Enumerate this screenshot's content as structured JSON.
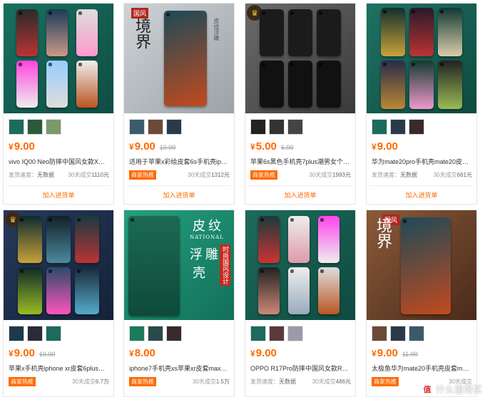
{
  "add_label": "加入进货单",
  "tag_label": "商家热推",
  "ship_label": "发货速度：",
  "ship_value": "无数据",
  "sales_prefix": "30天成交",
  "colors": {
    "accent": "#ff6a00"
  },
  "products": [
    {
      "price": "9.00",
      "original": "",
      "title": "vivo IQ00 Neo防摔中国风女款X27Pro...",
      "show_tag": false,
      "ship_value": "无数据",
      "sales": "1110元",
      "bg": "#1f6e5f",
      "image_text": ""
    },
    {
      "price": "9.00",
      "original": "10.00",
      "title": "适用于苹果x彩绘皮套6s手机壳iphone...",
      "show_tag": true,
      "sales": "1312元",
      "bg": "#274a55",
      "image_text": "境界"
    },
    {
      "price": "5.00",
      "original": "6.00",
      "title": "苹果6s黑色手机壳7plus潮男女个性六...",
      "show_tag": true,
      "sales": "1993元",
      "bg": "#555555",
      "image_text": ""
    },
    {
      "price": "9.00",
      "original": "",
      "title": "华为mate20pro手机壳mate20皮纹20x...",
      "show_tag": false,
      "ship_value": "无数据",
      "sales": "661元",
      "bg": "#1d6f60",
      "image_text": ""
    },
    {
      "price": "9.00",
      "original": "10.00",
      "title": "苹果x手机壳iphone xr皮套6plus浮雕...",
      "show_tag": true,
      "sales": "6.7万",
      "bg": "#1f2f4a",
      "image_text": ""
    },
    {
      "price": "8.00",
      "original": "",
      "title": "iphone7手机壳xs苹果xr皮套max华为...",
      "show_tag": true,
      "sales": "1.5万",
      "bg": "#1e8a6e",
      "image_text": "皮纹 NATIONAL 浮雕壳 时尚国风设计"
    },
    {
      "price": "9.00",
      "original": "",
      "title": "OPPO R17Pro防摔中国风女款R17手...",
      "show_tag": false,
      "ship_value": "无数据",
      "sales": "486元",
      "bg": "#1d6b5c",
      "image_text": ""
    },
    {
      "price": "9.00",
      "original": "11.00",
      "title": "太极鱼华为mate20手机壳皮套mate20...",
      "show_tag": true,
      "sales": "",
      "bg": "#6a4630",
      "image_text": "境界"
    }
  ],
  "image_texts": {
    "p2_ribbon": "国风",
    "p2_big": "境界",
    "p2_side": "皮纹浮雕",
    "p6_line1": "皮",
    "p6_line2": "纹",
    "p6_en": "NATIONAL",
    "p6_line3": "浮",
    "p6_line4": "雕",
    "p6_line5": "壳",
    "p6_red": "时尚国风设计",
    "p8_ribbon": "国风",
    "p8_big": "境界"
  },
  "watermark": "什么值得买"
}
